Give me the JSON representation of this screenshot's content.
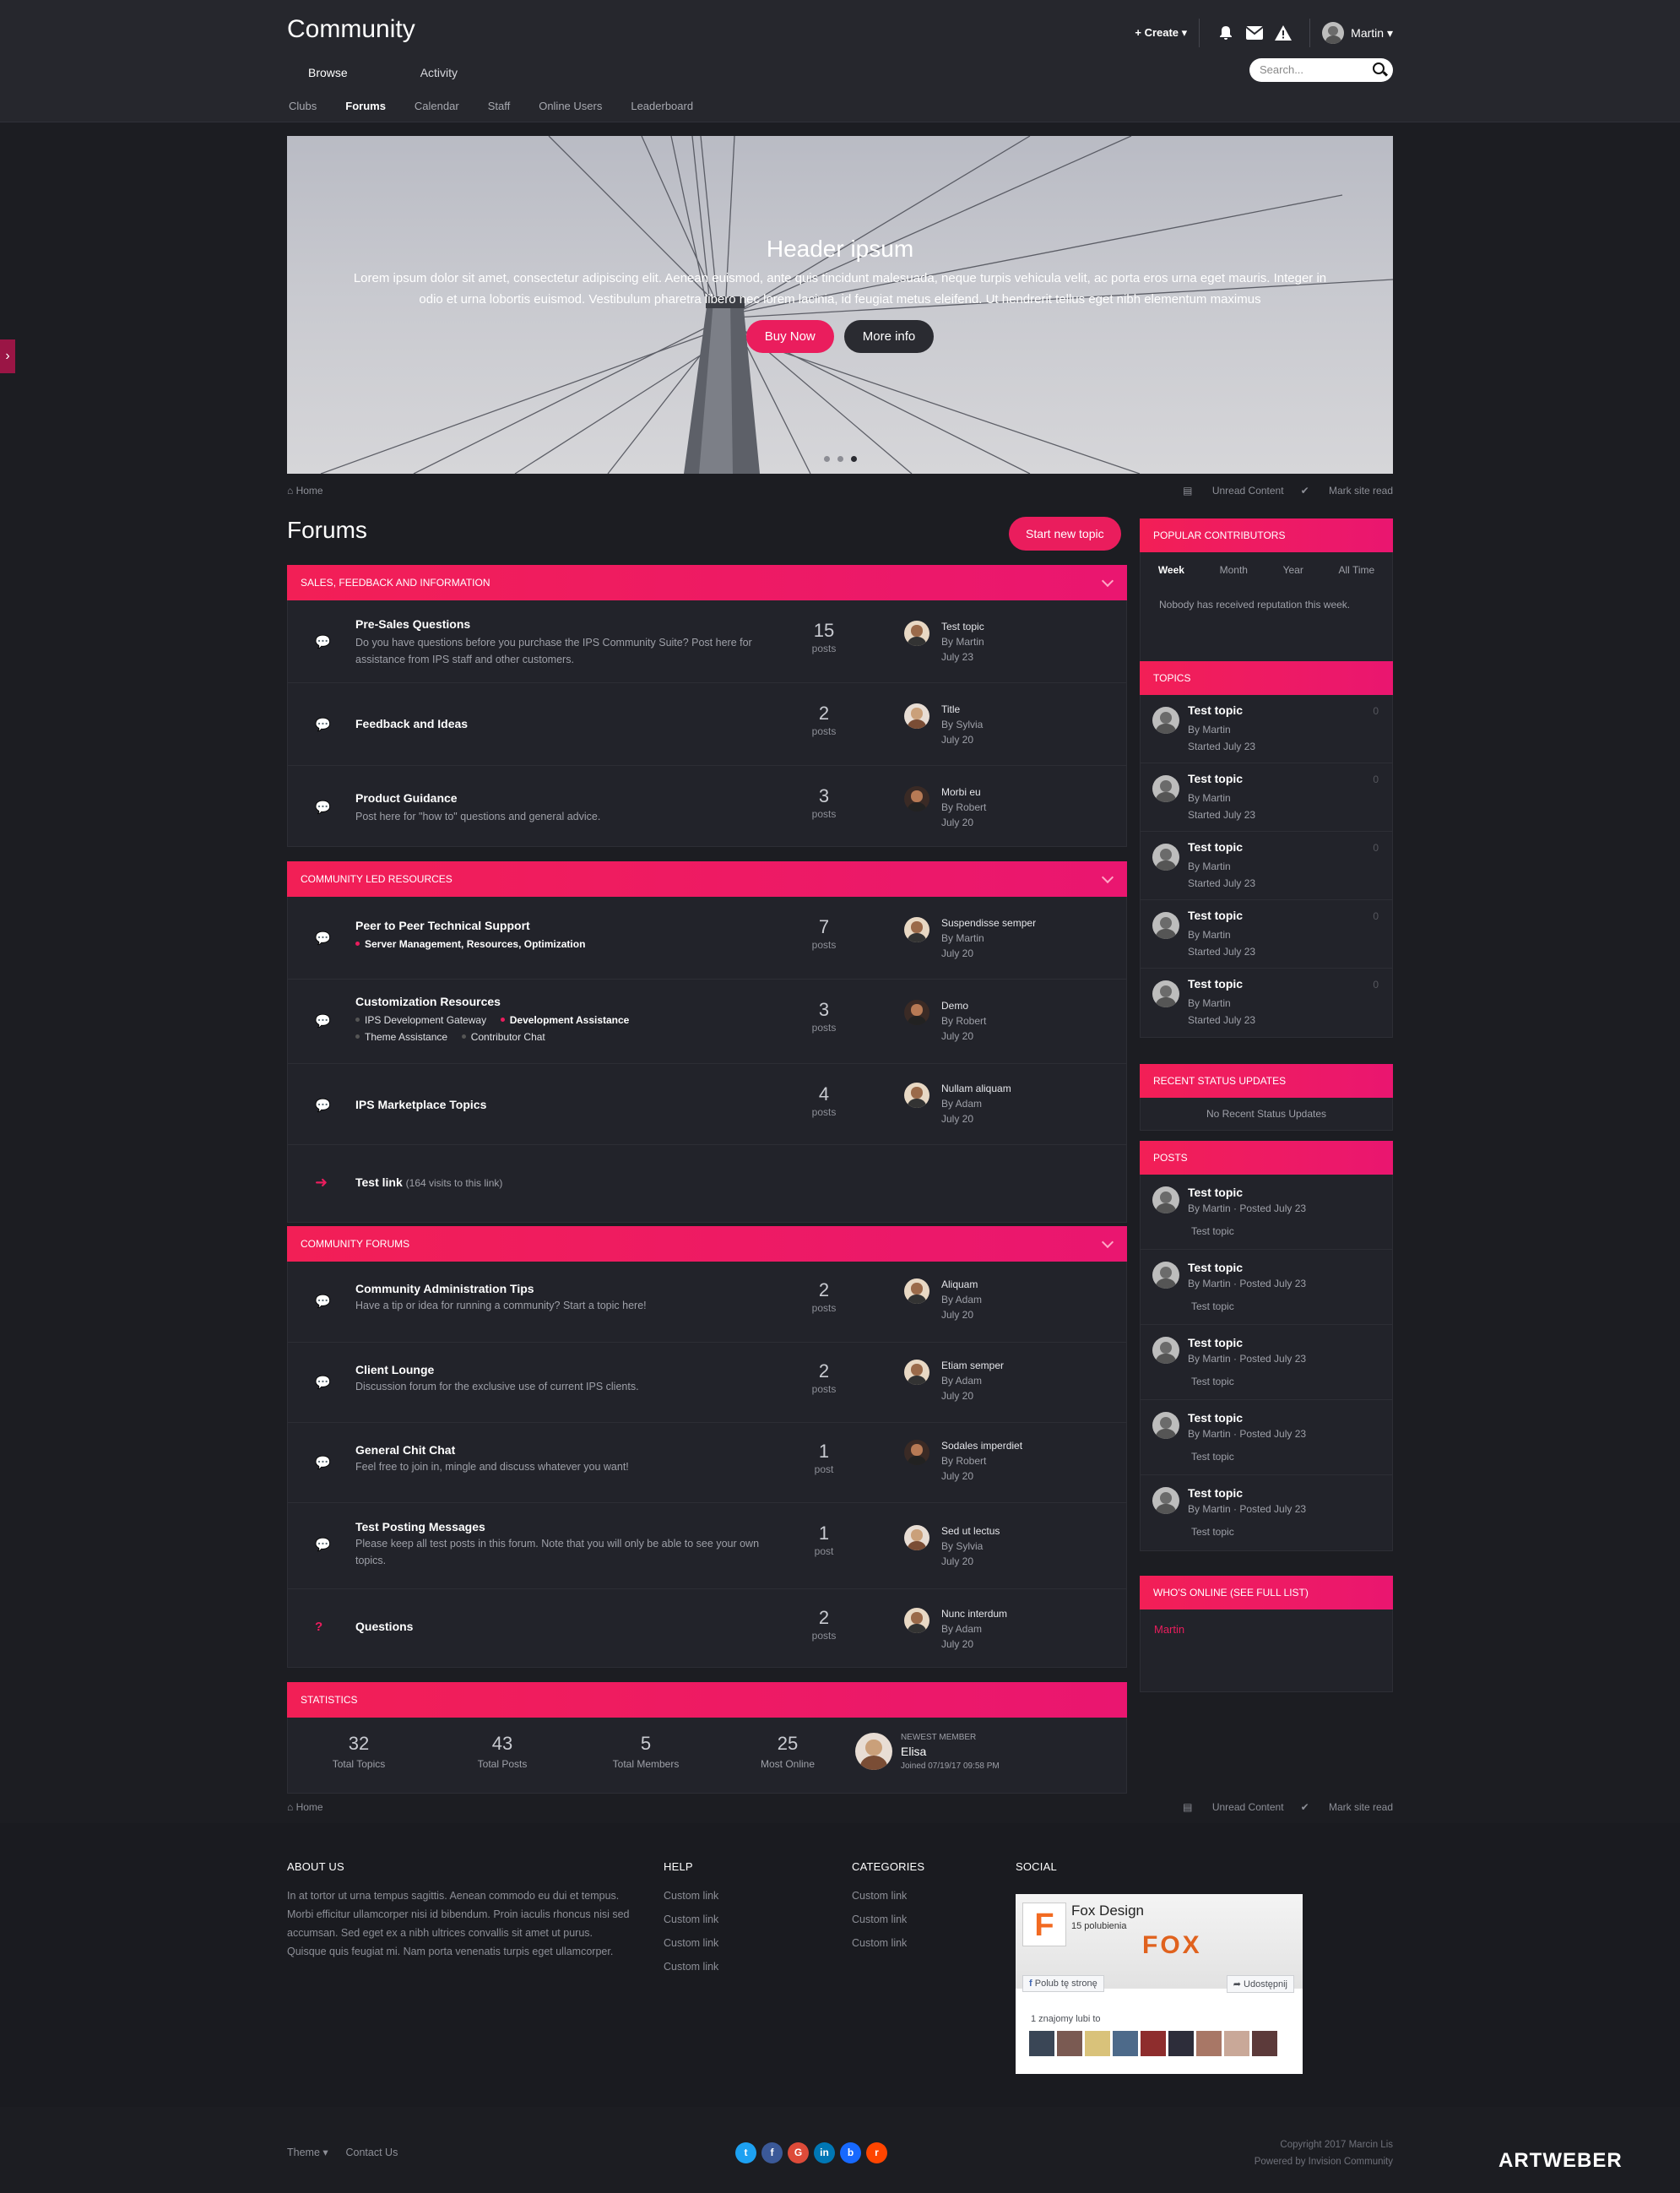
{
  "header": {
    "site_title": "Community",
    "create_label": "Create",
    "user_name": "Martin",
    "search_placeholder": "Search...",
    "main_nav": [
      "Browse",
      "Activity"
    ],
    "sub_nav": [
      "Clubs",
      "Forums",
      "Calendar",
      "Staff",
      "Online Users",
      "Leaderboard"
    ]
  },
  "hero": {
    "title": "Header ipsum",
    "body": "Lorem ipsum dolor sit amet, consectetur adipiscing elit. Aenean euismod, ante quis tincidunt malesuada, neque turpis vehicula velit, ac porta eros urna eget mauris. Integer in odio et urna lobortis euismod. Vestibulum pharetra libero nec lorem lacinia, id feugiat metus eleifend. Ut hendrerit tellus eget nibh elementum maximus",
    "btn_primary": "Buy Now",
    "btn_secondary": "More info"
  },
  "breadcrumb": {
    "home": "Home",
    "unread": "Unread Content",
    "mark_read": "Mark site read"
  },
  "forums_title": "Forums",
  "start_topic": "Start new topic",
  "categories": [
    {
      "title": "SALES, FEEDBACK AND INFORMATION",
      "forums": [
        {
          "title": "Pre-Sales Questions",
          "desc": "Do you have questions before you purchase the IPS Community Suite? Post here for assistance from IPS staff and other customers.",
          "count": "15",
          "count_label": "posts",
          "last_title": "Test topic",
          "last_by": "By Martin",
          "last_date": "July 23"
        },
        {
          "title": "Feedback and Ideas",
          "desc": "",
          "count": "2",
          "count_label": "posts",
          "last_title": "Title",
          "last_by": "By Sylvia",
          "last_date": "July 20"
        },
        {
          "title": "Product Guidance",
          "desc": "Post here for \"how to\" questions and general advice.",
          "count": "3",
          "count_label": "posts",
          "last_title": "Morbi eu",
          "last_by": "By Robert",
          "last_date": "July 20"
        }
      ]
    },
    {
      "title": "COMMUNITY LED RESOURCES",
      "forums": [
        {
          "title": "Peer to Peer Technical Support",
          "sub": "Server Management, Resources, Optimization",
          "count": "7",
          "count_label": "posts",
          "last_title": "Suspendisse semper",
          "last_by": "By Martin",
          "last_date": "July 20"
        },
        {
          "title": "Customization Resources",
          "sub1": "IPS Development Gateway",
          "sub2": "Development Assistance",
          "sub3": "Theme Assistance",
          "sub4": "Contributor Chat",
          "count": "3",
          "count_label": "posts",
          "last_title": "Demo",
          "last_by": "By Robert",
          "last_date": "July 20"
        },
        {
          "title": "IPS Marketplace Topics",
          "count": "4",
          "count_label": "posts",
          "last_title": "Nullam aliquam",
          "last_by": "By Adam",
          "last_date": "July 20"
        },
        {
          "title": "Test link",
          "extra": "(164 visits to this link)"
        }
      ]
    },
    {
      "title": "COMMUNITY FORUMS",
      "forums": [
        {
          "title": "Community Administration Tips",
          "desc": "Have a tip or idea for running a community? Start a topic here!",
          "count": "2",
          "count_label": "posts",
          "last_title": "Aliquam",
          "last_by": "By Adam",
          "last_date": "July 20"
        },
        {
          "title": "Client Lounge",
          "desc": "Discussion forum for the exclusive use of current IPS clients.",
          "count": "2",
          "count_label": "posts",
          "last_title": "Etiam semper",
          "last_by": "By Adam",
          "last_date": "July 20"
        },
        {
          "title": "General Chit Chat",
          "desc": "Feel free to join in, mingle and discuss whatever you want!",
          "count": "1",
          "count_label": "post",
          "last_title": "Sodales imperdiet",
          "last_by": "By Robert",
          "last_date": "July 20"
        },
        {
          "title": "Test Posting Messages",
          "desc": "Please keep all test posts in this forum. Note that you will only be able to see your own topics.",
          "count": "1",
          "count_label": "post",
          "last_title": "Sed ut lectus",
          "last_by": "By Sylvia",
          "last_date": "July 20"
        },
        {
          "title": "Questions",
          "count": "2",
          "count_label": "posts",
          "last_title": "Nunc interdum",
          "last_by": "By Adam",
          "last_date": "July 20"
        }
      ]
    }
  ],
  "statistics": {
    "title": "STATISTICS",
    "items": [
      {
        "n": "32",
        "l": "Total Topics"
      },
      {
        "n": "43",
        "l": "Total Posts"
      },
      {
        "n": "5",
        "l": "Total Members"
      },
      {
        "n": "25",
        "l": "Most Online"
      }
    ],
    "newest_label": "NEWEST MEMBER",
    "newest_name": "Elisa",
    "newest_joined": "Joined 07/19/17 09:58 PM"
  },
  "sidebar": {
    "popular": {
      "title": "POPULAR CONTRIBUTORS",
      "tabs": [
        "Week",
        "Month",
        "Year",
        "All Time"
      ],
      "empty": "Nobody has received reputation this week."
    },
    "topics": {
      "title": "TOPICS",
      "items": [
        {
          "t": "Test topic",
          "by": "By Martin",
          "d": "Started July 23",
          "c": "0"
        },
        {
          "t": "Test topic",
          "by": "By Martin",
          "d": "Started July 23",
          "c": "0"
        },
        {
          "t": "Test topic",
          "by": "By Martin",
          "d": "Started July 23",
          "c": "0"
        },
        {
          "t": "Test topic",
          "by": "By Martin",
          "d": "Started July 23",
          "c": "0"
        },
        {
          "t": "Test topic",
          "by": "By Martin",
          "d": "Started July 23",
          "c": "0"
        }
      ]
    },
    "status": {
      "title": "RECENT STATUS UPDATES",
      "empty": "No Recent Status Updates"
    },
    "posts": {
      "title": "POSTS",
      "items": [
        {
          "t": "Test topic",
          "m": "By Martin · Posted July 23",
          "e": "Test topic"
        },
        {
          "t": "Test topic",
          "m": "By Martin · Posted July 23",
          "e": "Test topic"
        },
        {
          "t": "Test topic",
          "m": "By Martin · Posted July 23",
          "e": "Test topic"
        },
        {
          "t": "Test topic",
          "m": "By Martin · Posted July 23",
          "e": "Test topic"
        },
        {
          "t": "Test topic",
          "m": "By Martin · Posted July 23",
          "e": "Test topic"
        }
      ]
    },
    "online": {
      "title": "WHO'S ONLINE (SEE FULL LIST)",
      "user": "Martin"
    }
  },
  "footer": {
    "about_title": "ABOUT US",
    "about_text": "In at tortor ut urna tempus sagittis. Aenean commodo eu dui et tempus. Morbi efficitur ullamcorper nisi id bibendum. Proin iaculis rhoncus nisi sed accumsan. Sed eget ex a nibh ultrices convallis sit amet ut purus. Quisque quis feugiat mi. Nam porta venenatis turpis eget ullamcorper.",
    "help_title": "HELP",
    "help_links": [
      "Custom link",
      "Custom link",
      "Custom link",
      "Custom link"
    ],
    "cat_title": "CATEGORIES",
    "cat_links": [
      "Custom link",
      "Custom link",
      "Custom link"
    ],
    "social_title": "SOCIAL",
    "fb": {
      "name": "Fox Design",
      "likes": "15 polubienia",
      "logo": "FOX",
      "like_btn": "Polub tę stronę",
      "share_btn": "Udostępnij",
      "friends": "1 znajomy lubi to"
    },
    "theme": "Theme",
    "contact": "Contact Us",
    "copyright": "Copyright 2017 Marcin Lis",
    "powered": "Powered by Invision Community",
    "watermark": "ARTWEBER"
  },
  "colors": {
    "accent": "#ea1d5d",
    "bg": "#1c1d22",
    "panel": "#22232a"
  }
}
